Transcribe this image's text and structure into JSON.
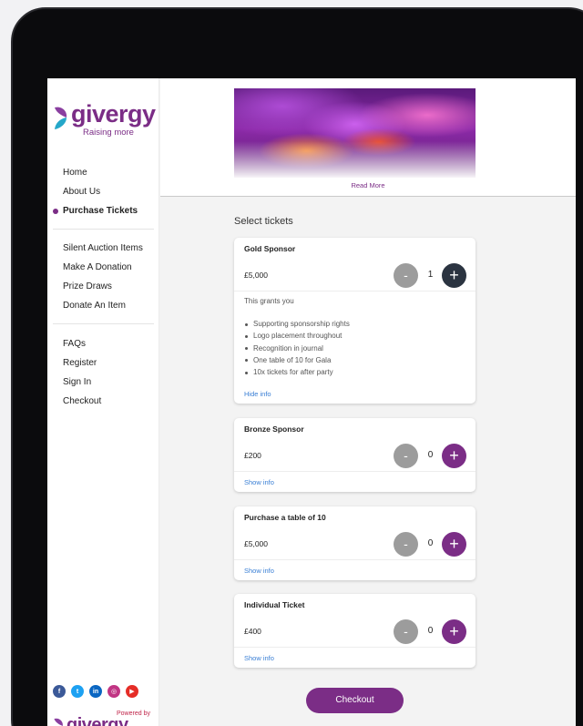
{
  "brand": {
    "name": "givergy",
    "tagline": "Raising more",
    "powered_by": "Powered by"
  },
  "nav": {
    "group1": [
      {
        "label": "Home",
        "active": false
      },
      {
        "label": "About Us",
        "active": false
      },
      {
        "label": "Purchase Tickets",
        "active": true
      }
    ],
    "group2": [
      {
        "label": "Silent Auction Items"
      },
      {
        "label": "Make A Donation"
      },
      {
        "label": "Prize Draws"
      },
      {
        "label": "Donate An Item"
      }
    ],
    "group3": [
      {
        "label": "FAQs"
      },
      {
        "label": "Register"
      },
      {
        "label": "Sign In"
      },
      {
        "label": "Checkout"
      }
    ]
  },
  "socials": [
    {
      "name": "facebook-icon",
      "glyph": "f",
      "color": "#3b5998"
    },
    {
      "name": "twitter-icon",
      "glyph": "t",
      "color": "#1da1f2"
    },
    {
      "name": "linkedin-icon",
      "glyph": "in",
      "color": "#0a66c2"
    },
    {
      "name": "instagram-icon",
      "glyph": "◎",
      "color": "#c13584"
    },
    {
      "name": "youtube-icon",
      "glyph": "▶",
      "color": "#e52d27"
    }
  ],
  "banner": {
    "read_more": "Read More"
  },
  "tickets": {
    "title": "Select tickets",
    "items": [
      {
        "name": "Gold Sponsor",
        "price": "£5,000",
        "qty": "1",
        "info_intro": "This grants you",
        "info_bullets": [
          "Supporting sponsorship rights",
          "Logo placement throughout",
          "Recognition in journal",
          "One table of 10 for Gala",
          "10x tickets for after party"
        ],
        "toggle": "Hide info"
      },
      {
        "name": "Bronze Sponsor",
        "price": "£200",
        "qty": "0",
        "toggle": "Show info"
      },
      {
        "name": "Purchase a table of 10",
        "price": "£5,000",
        "qty": "0",
        "toggle": "Show info"
      },
      {
        "name": "Individual Ticket",
        "price": "£400",
        "qty": "0",
        "toggle": "Show info"
      }
    ],
    "minus_label": "-",
    "plus_label": "+"
  },
  "checkout_label": "Checkout",
  "colors": {
    "brand_purple": "#7b2d86",
    "dark_button": "#2b3441",
    "grey_button": "#9c9c9c",
    "link_blue": "#3a7fd5"
  }
}
